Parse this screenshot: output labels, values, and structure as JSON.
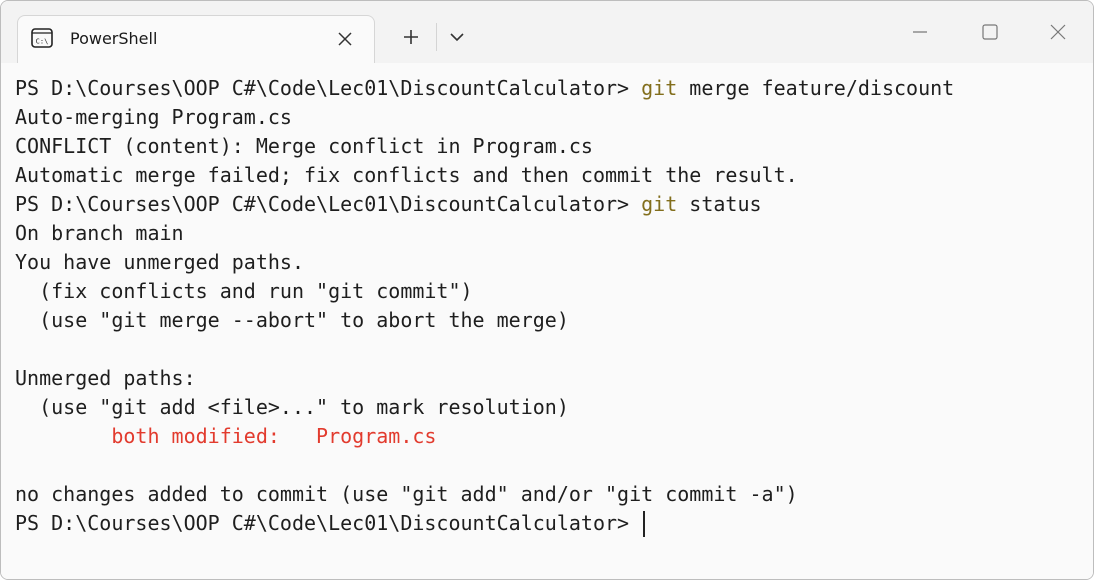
{
  "tab": {
    "title": "PowerShell",
    "icon": "terminal-icon",
    "close_icon": "close-icon"
  },
  "toolbar": {
    "new_tab_icon": "plus-icon",
    "dropdown_icon": "chevron-down-icon"
  },
  "window_controls": {
    "minimize_icon": "minimize-icon",
    "maximize_icon": "maximize-icon",
    "close_icon": "close-icon"
  },
  "colors": {
    "command": "#826e1c",
    "error": "#e23b2e",
    "text": "#1e1e1e"
  },
  "terminal": {
    "lines": [
      {
        "prompt": "PS D:\\Courses\\OOP C#\\Code\\Lec01\\DiscountCalculator> ",
        "cmd": "git",
        "rest": " merge feature/discount"
      },
      {
        "text": "Auto-merging Program.cs"
      },
      {
        "text": "CONFLICT (content): Merge conflict in Program.cs"
      },
      {
        "text": "Automatic merge failed; fix conflicts and then commit the result."
      },
      {
        "prompt": "PS D:\\Courses\\OOP C#\\Code\\Lec01\\DiscountCalculator> ",
        "cmd": "git",
        "rest": " status"
      },
      {
        "text": "On branch main"
      },
      {
        "text": "You have unmerged paths."
      },
      {
        "text": "  (fix conflicts and run \"git commit\")"
      },
      {
        "text": "  (use \"git merge --abort\" to abort the merge)"
      },
      {
        "text": ""
      },
      {
        "text": "Unmerged paths:"
      },
      {
        "text": "  (use \"git add <file>...\" to mark resolution)"
      },
      {
        "indent": "        ",
        "red": "both modified:   Program.cs"
      },
      {
        "text": ""
      },
      {
        "text": "no changes added to commit (use \"git add\" and/or \"git commit -a\")"
      },
      {
        "prompt": "PS D:\\Courses\\OOP C#\\Code\\Lec01\\DiscountCalculator> ",
        "cursor": true
      }
    ]
  }
}
